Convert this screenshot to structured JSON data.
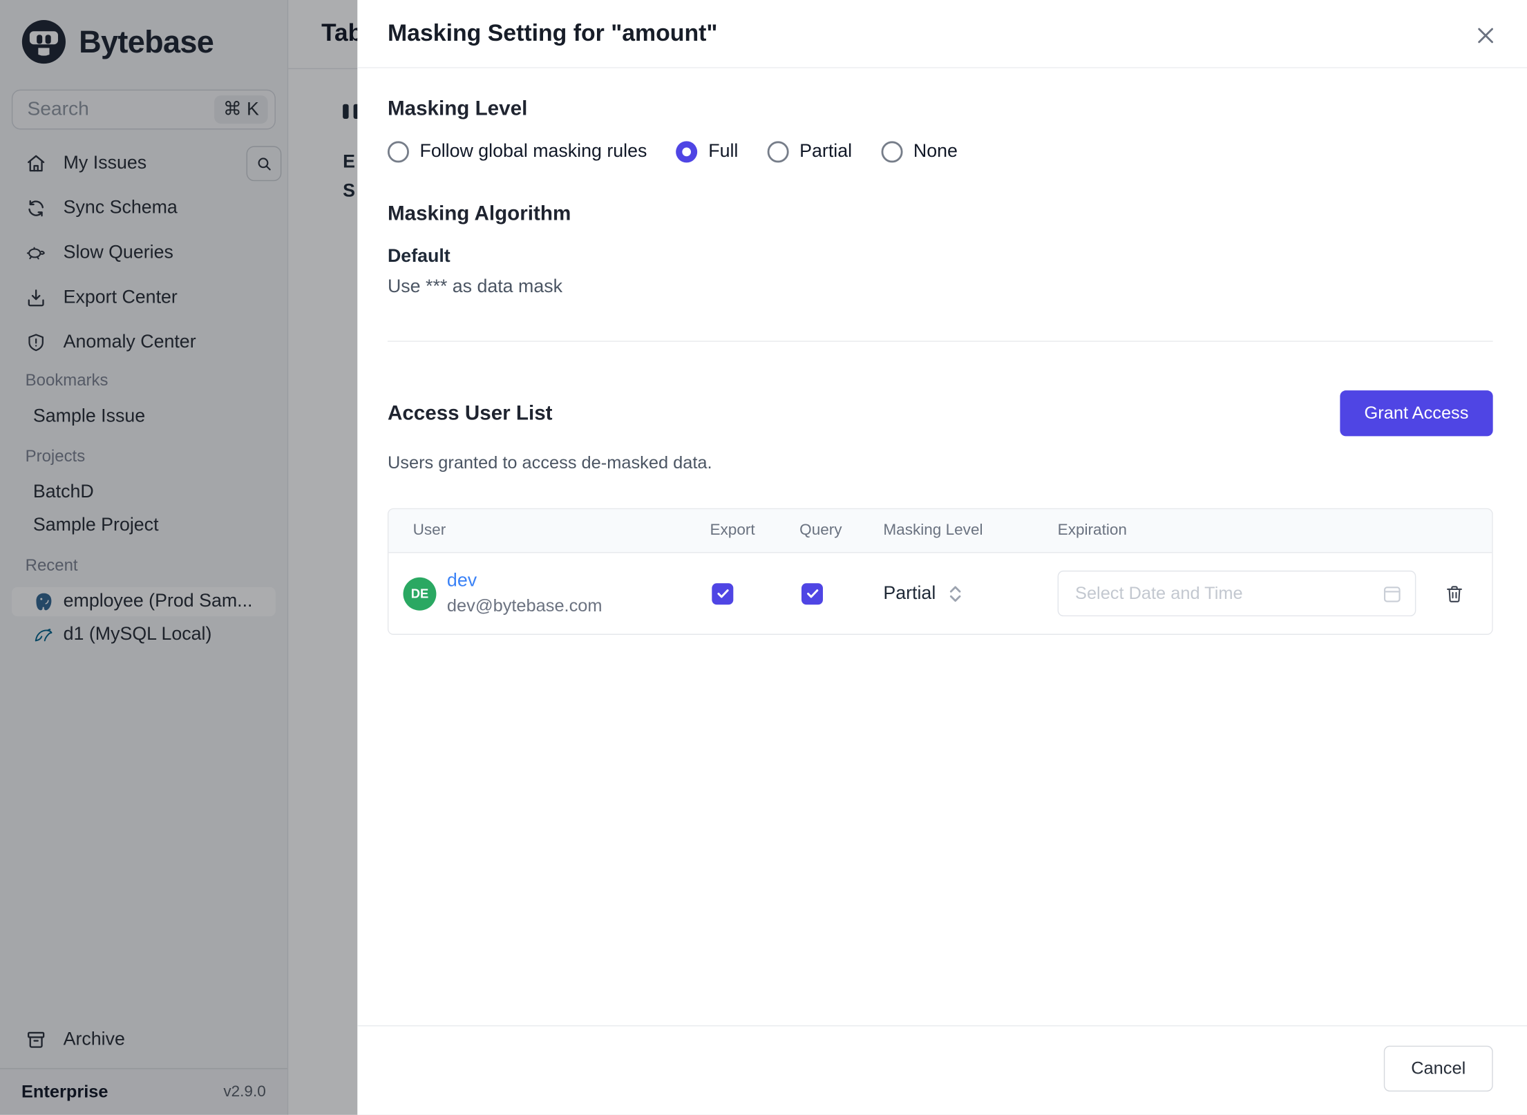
{
  "colors": {
    "accent": "#4f45e4",
    "link_blue": "#3b82f6",
    "avatar_green": "#2aa862",
    "logo_navy": "#1e2533"
  },
  "sidebar": {
    "logo_text": "Bytebase",
    "search": {
      "placeholder": "Search",
      "shortcut": "⌘ K"
    },
    "nav": [
      {
        "label": "My Issues",
        "icon": "home-icon"
      },
      {
        "label": "Sync Schema",
        "icon": "sync-icon"
      },
      {
        "label": "Slow Queries",
        "icon": "turtle-icon"
      },
      {
        "label": "Export Center",
        "icon": "download-icon"
      },
      {
        "label": "Anomaly Center",
        "icon": "shield-icon"
      }
    ],
    "sections": {
      "bookmarks": {
        "title": "Bookmarks",
        "items": [
          {
            "label": "Sample Issue"
          }
        ]
      },
      "projects": {
        "title": "Projects",
        "items": [
          {
            "label": "BatchD"
          },
          {
            "label": "Sample Project"
          }
        ]
      },
      "recent": {
        "title": "Recent",
        "items": [
          {
            "label": "employee (Prod Sam...",
            "db": "postgres",
            "selected": true
          },
          {
            "label": "d1 (MySQL Local)",
            "db": "mysql",
            "selected": false
          }
        ]
      }
    },
    "archive_label": "Archive",
    "plan": "Enterprise",
    "version": "v2.9.0"
  },
  "background": {
    "page_title": "Tab",
    "label_e": "E",
    "label_s": "S"
  },
  "modal": {
    "title": "Masking Setting for \"amount\"",
    "masking_level": {
      "heading": "Masking Level",
      "options": [
        {
          "label": "Follow global masking rules",
          "selected": false
        },
        {
          "label": "Full",
          "selected": true
        },
        {
          "label": "Partial",
          "selected": false
        },
        {
          "label": "None",
          "selected": false
        }
      ]
    },
    "algorithm": {
      "heading": "Masking Algorithm",
      "name": "Default",
      "description": "Use *** as data mask"
    },
    "access": {
      "heading": "Access User List",
      "grant_button": "Grant Access",
      "subtitle": "Users granted to access de-masked data."
    },
    "table": {
      "headers": [
        "User",
        "Export",
        "Query",
        "Masking Level",
        "Expiration"
      ],
      "rows": [
        {
          "initials": "DE",
          "name": "dev",
          "email": "dev@bytebase.com",
          "export_checked": true,
          "query_checked": true,
          "masking_level": "Partial",
          "expiration_placeholder": "Select Date and Time"
        }
      ]
    },
    "footer": {
      "cancel_label": "Cancel"
    }
  }
}
